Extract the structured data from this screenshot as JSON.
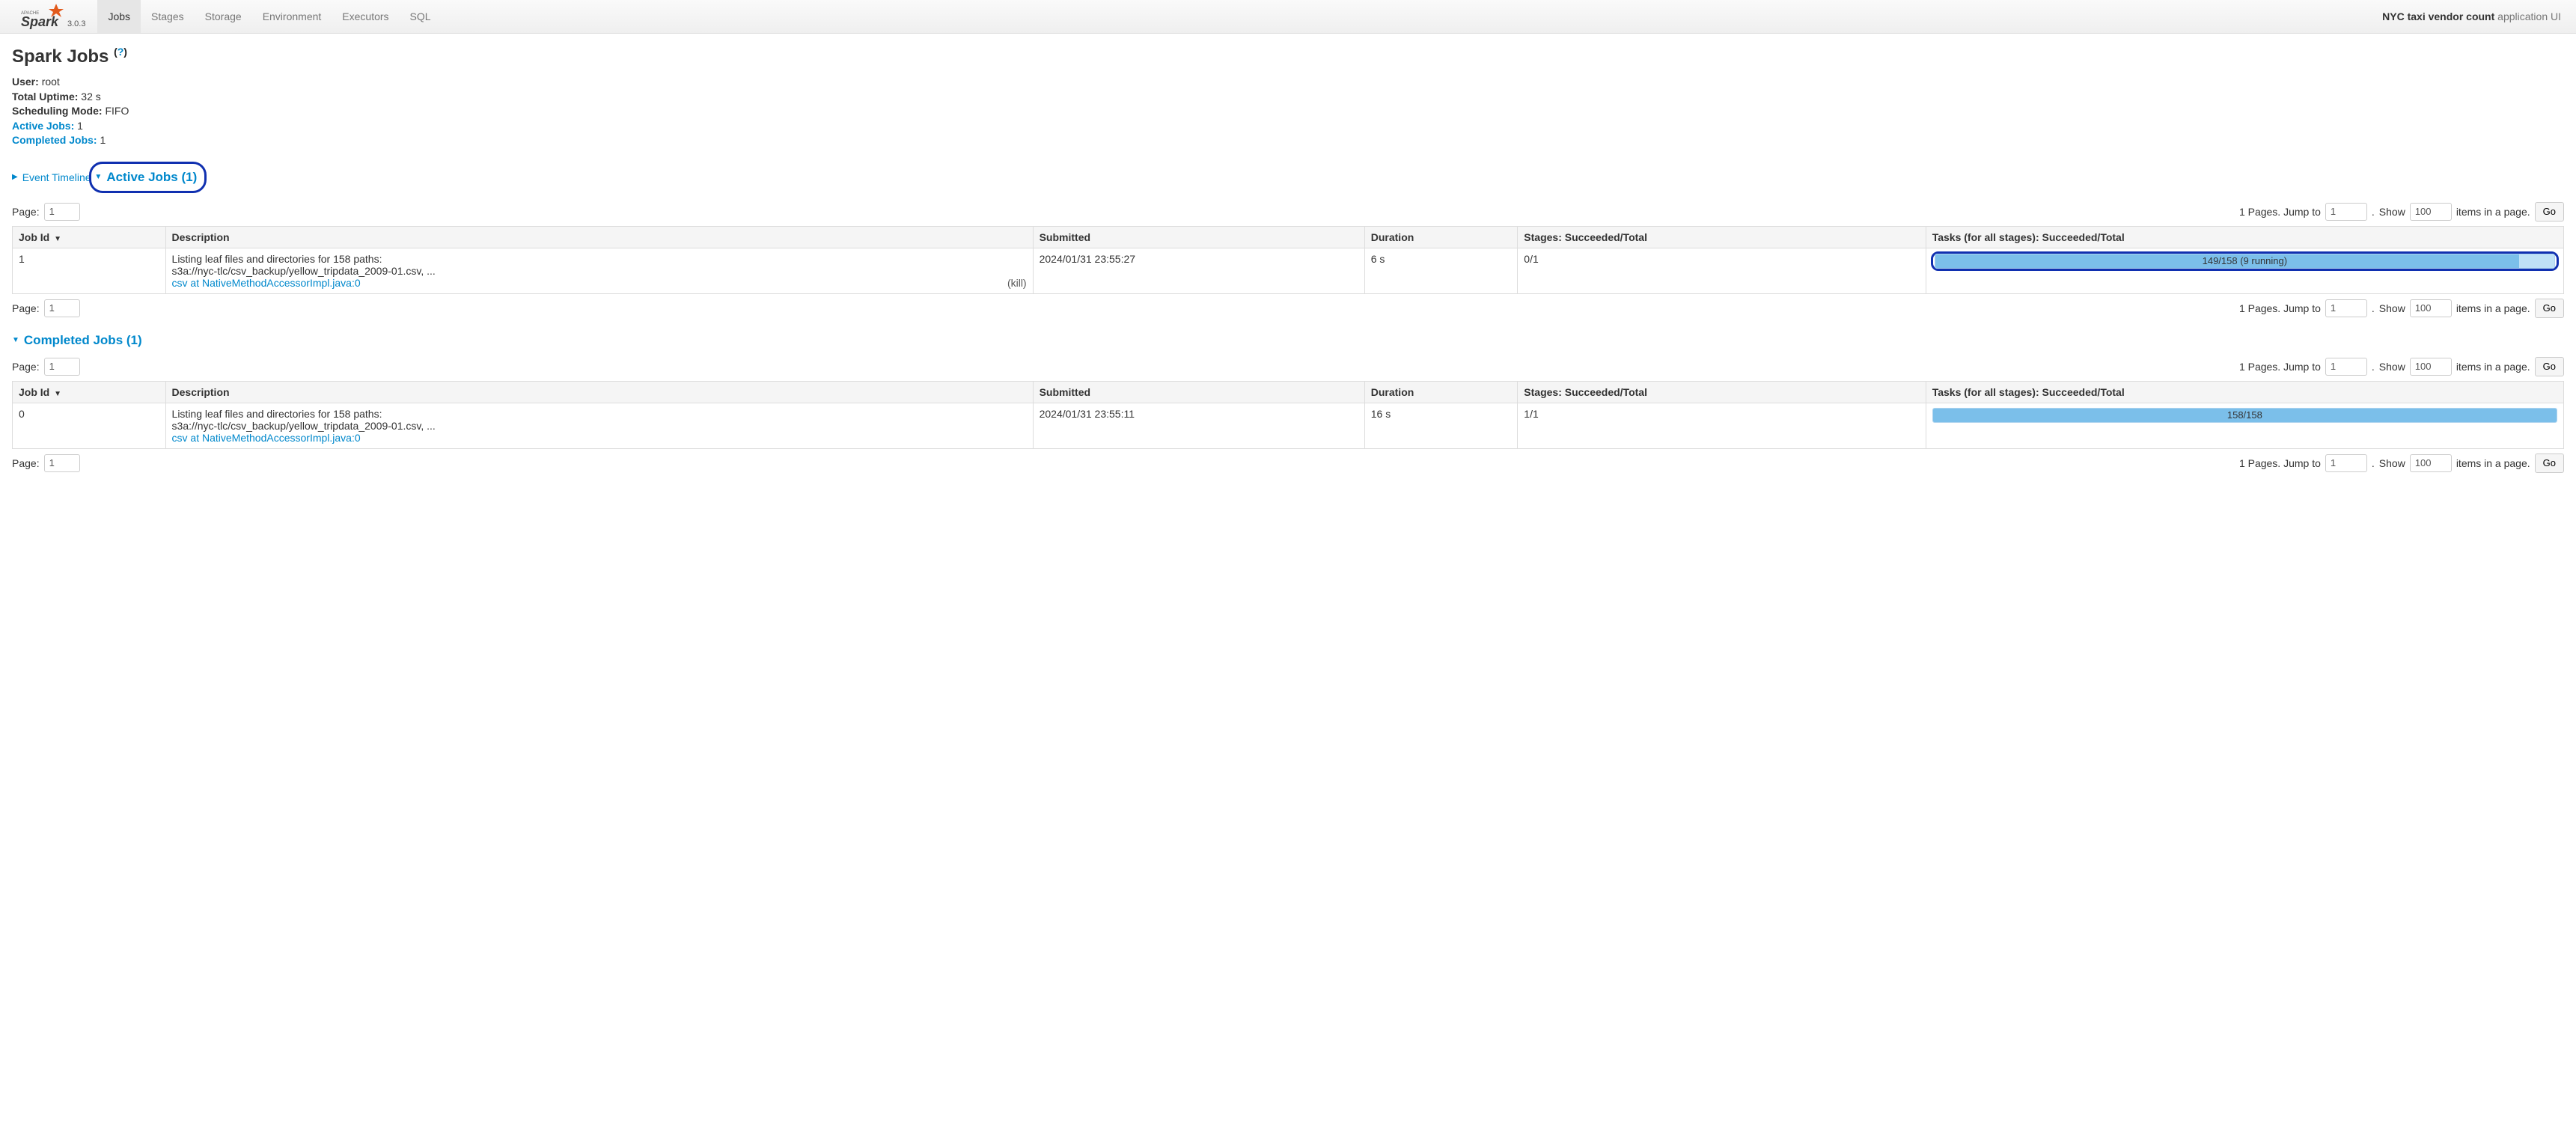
{
  "brand": {
    "version": "3.0.3"
  },
  "nav": {
    "tabs": [
      {
        "label": "Jobs",
        "active": true
      },
      {
        "label": "Stages"
      },
      {
        "label": "Storage"
      },
      {
        "label": "Environment"
      },
      {
        "label": "Executors"
      },
      {
        "label": "SQL"
      }
    ],
    "app_name_bold": "NYC taxi vendor count",
    "app_name_rest": " application UI"
  },
  "page": {
    "title": "Spark Jobs",
    "help": "?"
  },
  "summary": {
    "user_label": "User:",
    "user_value": "root",
    "uptime_label": "Total Uptime:",
    "uptime_value": "32 s",
    "sched_label": "Scheduling Mode:",
    "sched_value": "FIFO",
    "active_label": "Active Jobs:",
    "active_value": "1",
    "completed_label": "Completed Jobs:",
    "completed_value": "1"
  },
  "event_timeline_label": "Event Timeline",
  "active_section": {
    "title": "Active Jobs (1)"
  },
  "completed_section": {
    "title": "Completed Jobs (1)"
  },
  "pager": {
    "page_label": "Page:",
    "page_value": "1",
    "pages_text": "1 Pages. Jump to",
    "jump_value": "1",
    "dot": ".",
    "show_label": "Show",
    "show_value": "100",
    "items_text": "items in a page.",
    "go_label": "Go"
  },
  "cols": {
    "id": "Job Id",
    "desc": "Description",
    "submitted": "Submitted",
    "duration": "Duration",
    "stages": "Stages: Succeeded/Total",
    "tasks": "Tasks (for all stages): Succeeded/Total"
  },
  "active_row": {
    "id": "1",
    "desc_line1": "Listing leaf files and directories for 158 paths:",
    "desc_line2": "s3a://nyc-tlc/csv_backup/yellow_tripdata_2009-01.csv, ...",
    "desc_link": "csv at NativeMethodAccessorImpl.java:0",
    "kill": "(kill)",
    "submitted": "2024/01/31 23:55:27",
    "duration": "6 s",
    "stages": "0/1",
    "tasks_label": "149/158 (9 running)",
    "done_pct": 94.3,
    "running_pct": 5.7
  },
  "completed_row": {
    "id": "0",
    "desc_line1": "Listing leaf files and directories for 158 paths:",
    "desc_line2": "s3a://nyc-tlc/csv_backup/yellow_tripdata_2009-01.csv, ...",
    "desc_link": "csv at NativeMethodAccessorImpl.java:0",
    "submitted": "2024/01/31 23:55:11",
    "duration": "16 s",
    "stages": "1/1",
    "tasks_label": "158/158",
    "done_pct": 100,
    "running_pct": 0
  }
}
